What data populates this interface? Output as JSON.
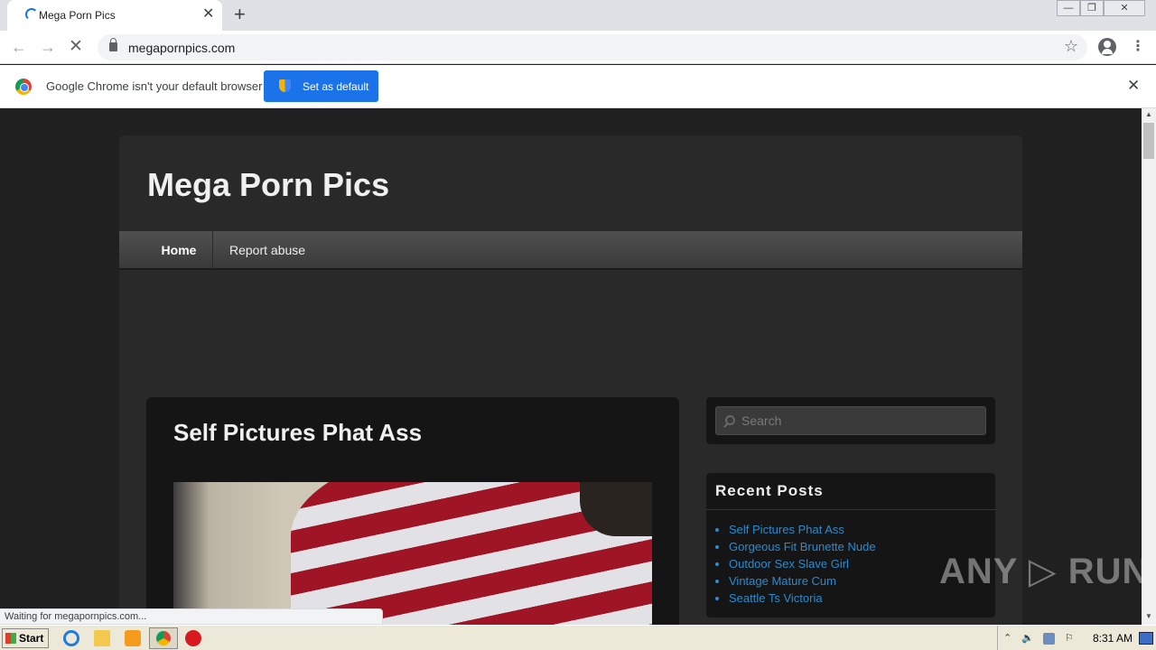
{
  "browser": {
    "tab_title": "Mega Porn Pics",
    "tab_close": "✕",
    "new_tab": "+",
    "url": "megapornpics.com",
    "nav_back": "←",
    "nav_forward": "→",
    "nav_stop": "✕",
    "star": "☆",
    "menu": "⋮",
    "window_minimize": "—",
    "window_restore": "❐",
    "window_close": "✕"
  },
  "infobar": {
    "message": "Google Chrome isn't your default browser",
    "button_label": "Set as default",
    "close": "✕"
  },
  "site": {
    "title": "Mega Porn Pics",
    "nav": [
      "Home",
      "Report abuse"
    ],
    "post_title": "Self Pictures Phat Ass",
    "search_placeholder": "Search",
    "recent_posts_title": "Recent Posts",
    "recent_posts": [
      "Self Pictures Phat Ass",
      "Gorgeous Fit Brunette Nude",
      "Outdoor Sex Slave Girl",
      "Vintage Mature Cum",
      "Seattle Ts Victoria"
    ],
    "link_color": "#2a8bd1"
  },
  "status_text": "Waiting for megapornpics.com...",
  "watermark": "ANY ▷ RUN",
  "taskbar": {
    "start_label": "Start",
    "clock": "8:31 AM",
    "tray_chevron": "⌃",
    "tray_speaker": "🔈",
    "tray_flag": "⚐"
  }
}
